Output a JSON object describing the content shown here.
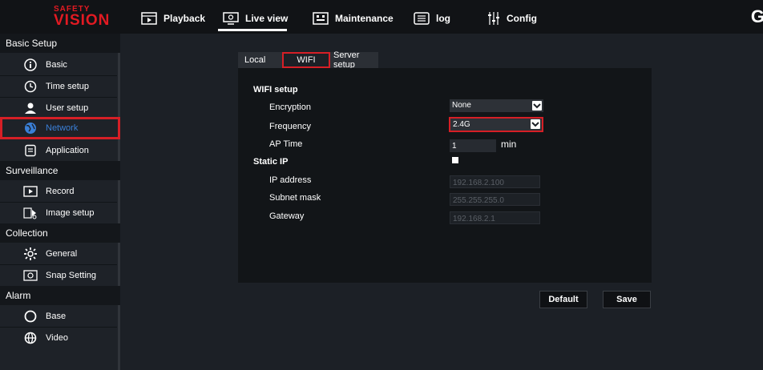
{
  "brand": {
    "top": "SAFETY",
    "name": "VISION",
    "accent": "#e21a22"
  },
  "nav": [
    {
      "label": "Playback",
      "icon": "playback-icon"
    },
    {
      "label": "Live view",
      "icon": "live-view-icon",
      "active": true
    },
    {
      "label": "Maintenance",
      "icon": "maintenance-icon"
    },
    {
      "label": "log",
      "icon": "log-icon"
    },
    {
      "label": "Config",
      "icon": "config-icon"
    }
  ],
  "edge_glyph": "G",
  "sidebar": {
    "groups": [
      "Basic Setup",
      "Surveillance",
      "Collection",
      "Alarm"
    ],
    "items": [
      {
        "label": "Basic",
        "icon": "info-icon"
      },
      {
        "label": "Time setup",
        "icon": "clock-icon"
      },
      {
        "label": "User setup",
        "icon": "user-icon"
      },
      {
        "label": "Network",
        "icon": "network-globe-icon",
        "active": true
      },
      {
        "label": "Application",
        "icon": "application-icon"
      },
      {
        "label": "Record",
        "icon": "record-icon"
      },
      {
        "label": "Image setup",
        "icon": "image-setup-icon"
      },
      {
        "label": "General",
        "icon": "general-gear-icon"
      },
      {
        "label": "Snap Setting",
        "icon": "camera-icon"
      },
      {
        "label": "Base",
        "icon": "circle-icon"
      },
      {
        "label": "Video",
        "icon": "video-globe-icon"
      }
    ]
  },
  "tabs": [
    {
      "label": "Local"
    },
    {
      "label": "WIFI",
      "active": true
    },
    {
      "label": "Server setup"
    }
  ],
  "wifi": {
    "section_title": "WIFI setup",
    "encryption_label": "Encryption",
    "encryption_value": "None",
    "frequency_label": "Frequency",
    "frequency_value": "2.4G",
    "ap_time_label": "AP Time",
    "ap_time_value": "1",
    "ap_time_unit": "min"
  },
  "static_ip": {
    "title": "Static IP",
    "checked": true,
    "ip_label": "IP address",
    "ip_value": "192.168.2.100",
    "subnet_label": "Subnet mask",
    "subnet_value": "255.255.255.0",
    "gateway_label": "Gateway",
    "gateway_value": "192.168.2.1"
  },
  "buttons": {
    "default": "Default",
    "save": "Save"
  },
  "colors": {
    "highlight": "#d61f26",
    "active_text": "#3a7fd6"
  }
}
